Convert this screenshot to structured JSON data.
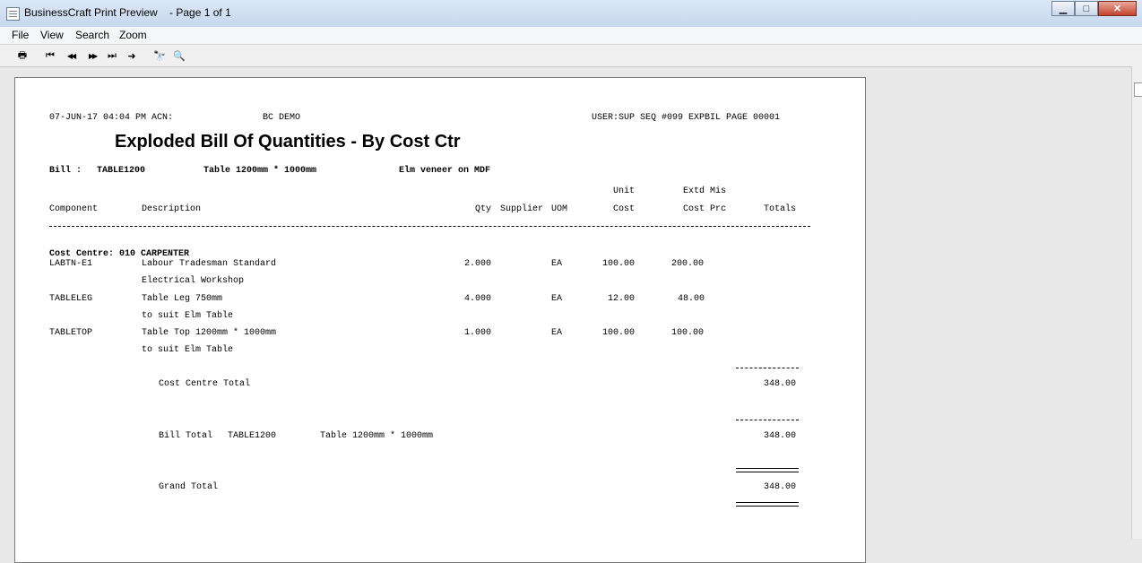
{
  "window": {
    "title": "BusinessCraft Print Preview    - Page 1 of 1"
  },
  "menu": {
    "file": "File",
    "view": "View",
    "search": "Search",
    "zoom": "Zoom"
  },
  "toolbar": {
    "print_icon": "🖶",
    "first_icon": "⏮",
    "prev_icon": "◀◀",
    "next_icon": "▶▶",
    "last_icon": "⏭",
    "goto_icon": "➜",
    "find_icon": "🔭",
    "zoom_icon": "🔍"
  },
  "report": {
    "header_left": "07-JUN-17 04:04 PM ACN:",
    "header_company": "BC DEMO",
    "header_right": "USER:SUP SEQ #099 EXPBIL PAGE 00001",
    "title": "Exploded Bill Of Quantities - By Cost Ctr",
    "bill_label": "Bill :",
    "bill_code": "TABLE1200",
    "bill_desc": "Table 1200mm * 1000mm",
    "bill_desc2": "Elm veneer on MDF",
    "columns": {
      "component": "Component",
      "description": "Description",
      "qty": "Qty",
      "supplier": "Supplier",
      "uom": "UOM",
      "unit_top": "Unit",
      "unit_bottom": "Cost",
      "extd_top": "Extd Mis",
      "extd_bottom": "Cost Prc",
      "totals": "Totals"
    },
    "cost_centre": "Cost Centre: 010 CARPENTER",
    "rows": [
      {
        "component": "LABTN-E1",
        "desc1": "Labour Tradesman Standard",
        "desc2": "Electrical Workshop",
        "qty": "2.000",
        "uom": "EA",
        "unit": "100.00",
        "extd": "200.00"
      },
      {
        "component": "TABLELEG",
        "desc1": "Table Leg 750mm",
        "desc2": "to suit Elm Table",
        "qty": "4.000",
        "uom": "EA",
        "unit": "12.00",
        "extd": "48.00"
      },
      {
        "component": "TABLETOP",
        "desc1": "Table Top 1200mm * 1000mm",
        "desc2": "to suit Elm Table",
        "qty": "1.000",
        "uom": "EA",
        "unit": "100.00",
        "extd": "100.00"
      }
    ],
    "cc_total_label": "Cost Centre Total",
    "cc_total": "348.00",
    "bill_total_label": "Bill Total",
    "bill_total_code": "TABLE1200",
    "bill_total_desc": "Table 1200mm * 1000mm",
    "bill_total": "348.00",
    "grand_total_label": "Grand Total",
    "grand_total": "348.00"
  }
}
